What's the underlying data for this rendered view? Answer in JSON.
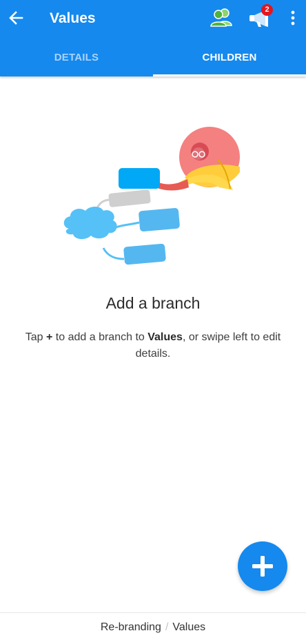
{
  "header": {
    "title": "Values",
    "notification_count": "2",
    "back_icon": "arrow-left-icon",
    "people_icon": "collaborators-icon",
    "megaphone_icon": "megaphone-icon",
    "more_icon": "more-vertical-icon"
  },
  "tabs": [
    {
      "label": "DETAILS",
      "active": false
    },
    {
      "label": "CHILDREN",
      "active": true
    }
  ],
  "empty_state": {
    "title": "Add a branch",
    "body_prefix": "Tap ",
    "body_plus": "+",
    "body_middle": " to add a branch to ",
    "body_target": "Values",
    "body_suffix": ", or swipe left to edit details."
  },
  "fab": {
    "icon": "plus-icon"
  },
  "breadcrumb": {
    "parent": "Re-branding",
    "separator": "/",
    "current": "Values"
  },
  "colors": {
    "primary": "#1589ee",
    "tab_inactive": "#a9d3fb",
    "badge": "#e3161d"
  }
}
